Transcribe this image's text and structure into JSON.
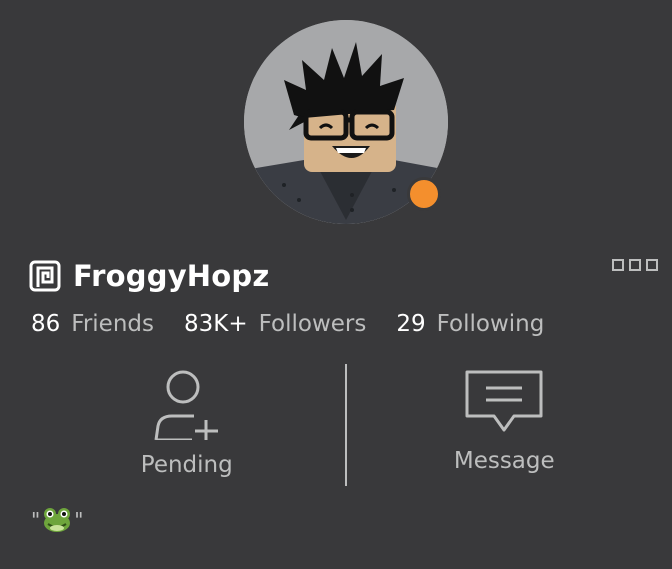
{
  "profile": {
    "display_name": "FroggyHopz",
    "presence_status_color": "#f48f2d",
    "bio": {
      "open_quote": "\"",
      "emoji": "frog-emoji",
      "close_quote": "\""
    }
  },
  "stats": {
    "friends": {
      "count": "86",
      "label": "Friends"
    },
    "followers": {
      "count": "83K+",
      "label": "Followers"
    },
    "following": {
      "count": "29",
      "label": "Following"
    }
  },
  "actions": {
    "pending_label": "Pending",
    "message_label": "Message"
  },
  "icons": {
    "premium": "premium-badge-icon",
    "more": "more-options-icon",
    "pending": "add-friend-pending-icon",
    "message": "message-icon"
  },
  "colors": {
    "background": "#39393b",
    "primary_text": "#ffffff",
    "secondary_text": "#bdbebe",
    "presence": "#f48f2d"
  }
}
